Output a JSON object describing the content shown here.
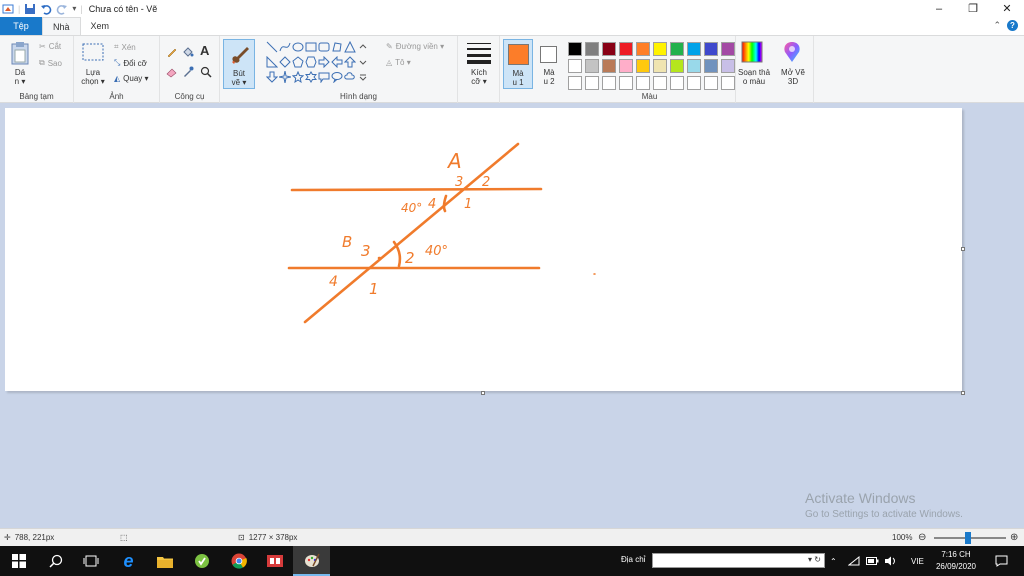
{
  "title_bar": {
    "title": "Chưa có tên - Vẽ",
    "minimize": "–",
    "maximize": "❐",
    "close": "✕"
  },
  "tabs": [
    {
      "label": "Tệp"
    },
    {
      "label": "Nhà"
    },
    {
      "label": "Xem"
    }
  ],
  "ribbon": {
    "clipboard": {
      "paste_label": "Dá",
      "paste_sub": "n ▾",
      "cut": "Cắt",
      "copy": "Sao",
      "group": "Bảng tạm"
    },
    "image": {
      "select_label": "Lựa",
      "select_sub": "chọn ▾",
      "crop": "Xén",
      "resize": "Đổi cỡ",
      "rotate": "Quay ▾",
      "group": "Ảnh"
    },
    "tools": {
      "group": "Công cụ"
    },
    "brushes": {
      "label": "Bút",
      "sub": "vẽ ▾"
    },
    "shapes": {
      "outline": "Đường viền ▾",
      "fill": "Tô ▾",
      "group": "Hình dạng"
    },
    "size": {
      "label": "Kích",
      "sub": "cỡ ▾"
    },
    "color1": {
      "label": "Mà",
      "sub": "u 1",
      "value": "#fc7d29"
    },
    "color2": {
      "label": "Mà",
      "sub": "u 2",
      "value": "#ffffff"
    },
    "palette": [
      "#000000",
      "#7f7f7f",
      "#880015",
      "#ed1c24",
      "#ff7f27",
      "#fff200",
      "#22b14c",
      "#00a2e8",
      "#3f48cc",
      "#a349a4",
      "#ffffff",
      "#c3c3c3",
      "#b97a57",
      "#ffaec9",
      "#ffc90e",
      "#efe4b0",
      "#b5e61d",
      "#99d9ea",
      "#7092be",
      "#c8bfe7",
      "#ffffff",
      "#ffffff",
      "#ffffff",
      "#ffffff",
      "#ffffff",
      "#ffffff",
      "#ffffff",
      "#ffffff",
      "#ffffff",
      "#ffffff"
    ],
    "colors_group": "Màu",
    "edit_colors": {
      "label": "Soạn thả",
      "sub": "o màu"
    },
    "paint3d": {
      "label": "Mở Vẽ",
      "sub": "3D"
    }
  },
  "drawing": {
    "stroke": "#f07b2c",
    "labels": {
      "A": "A",
      "a3": "3",
      "a2": "2",
      "a4": "4",
      "a1": "1",
      "a_angle": "40°",
      "B": "B",
      "b3": "3",
      "b2": "2",
      "b_angle": "40°",
      "b4": "4",
      "b1": "1"
    }
  },
  "watermark": {
    "title": "Activate Windows",
    "subtitle": "Go to Settings to activate Windows."
  },
  "status_bar": {
    "cursor_pos": "788, 221px",
    "canvas_size": "1277 × 378px",
    "zoom": "100%"
  },
  "taskbar": {
    "address_label": "Địa chỉ",
    "language": "VIE",
    "time": "7:16 CH",
    "date": "26/09/2020"
  }
}
